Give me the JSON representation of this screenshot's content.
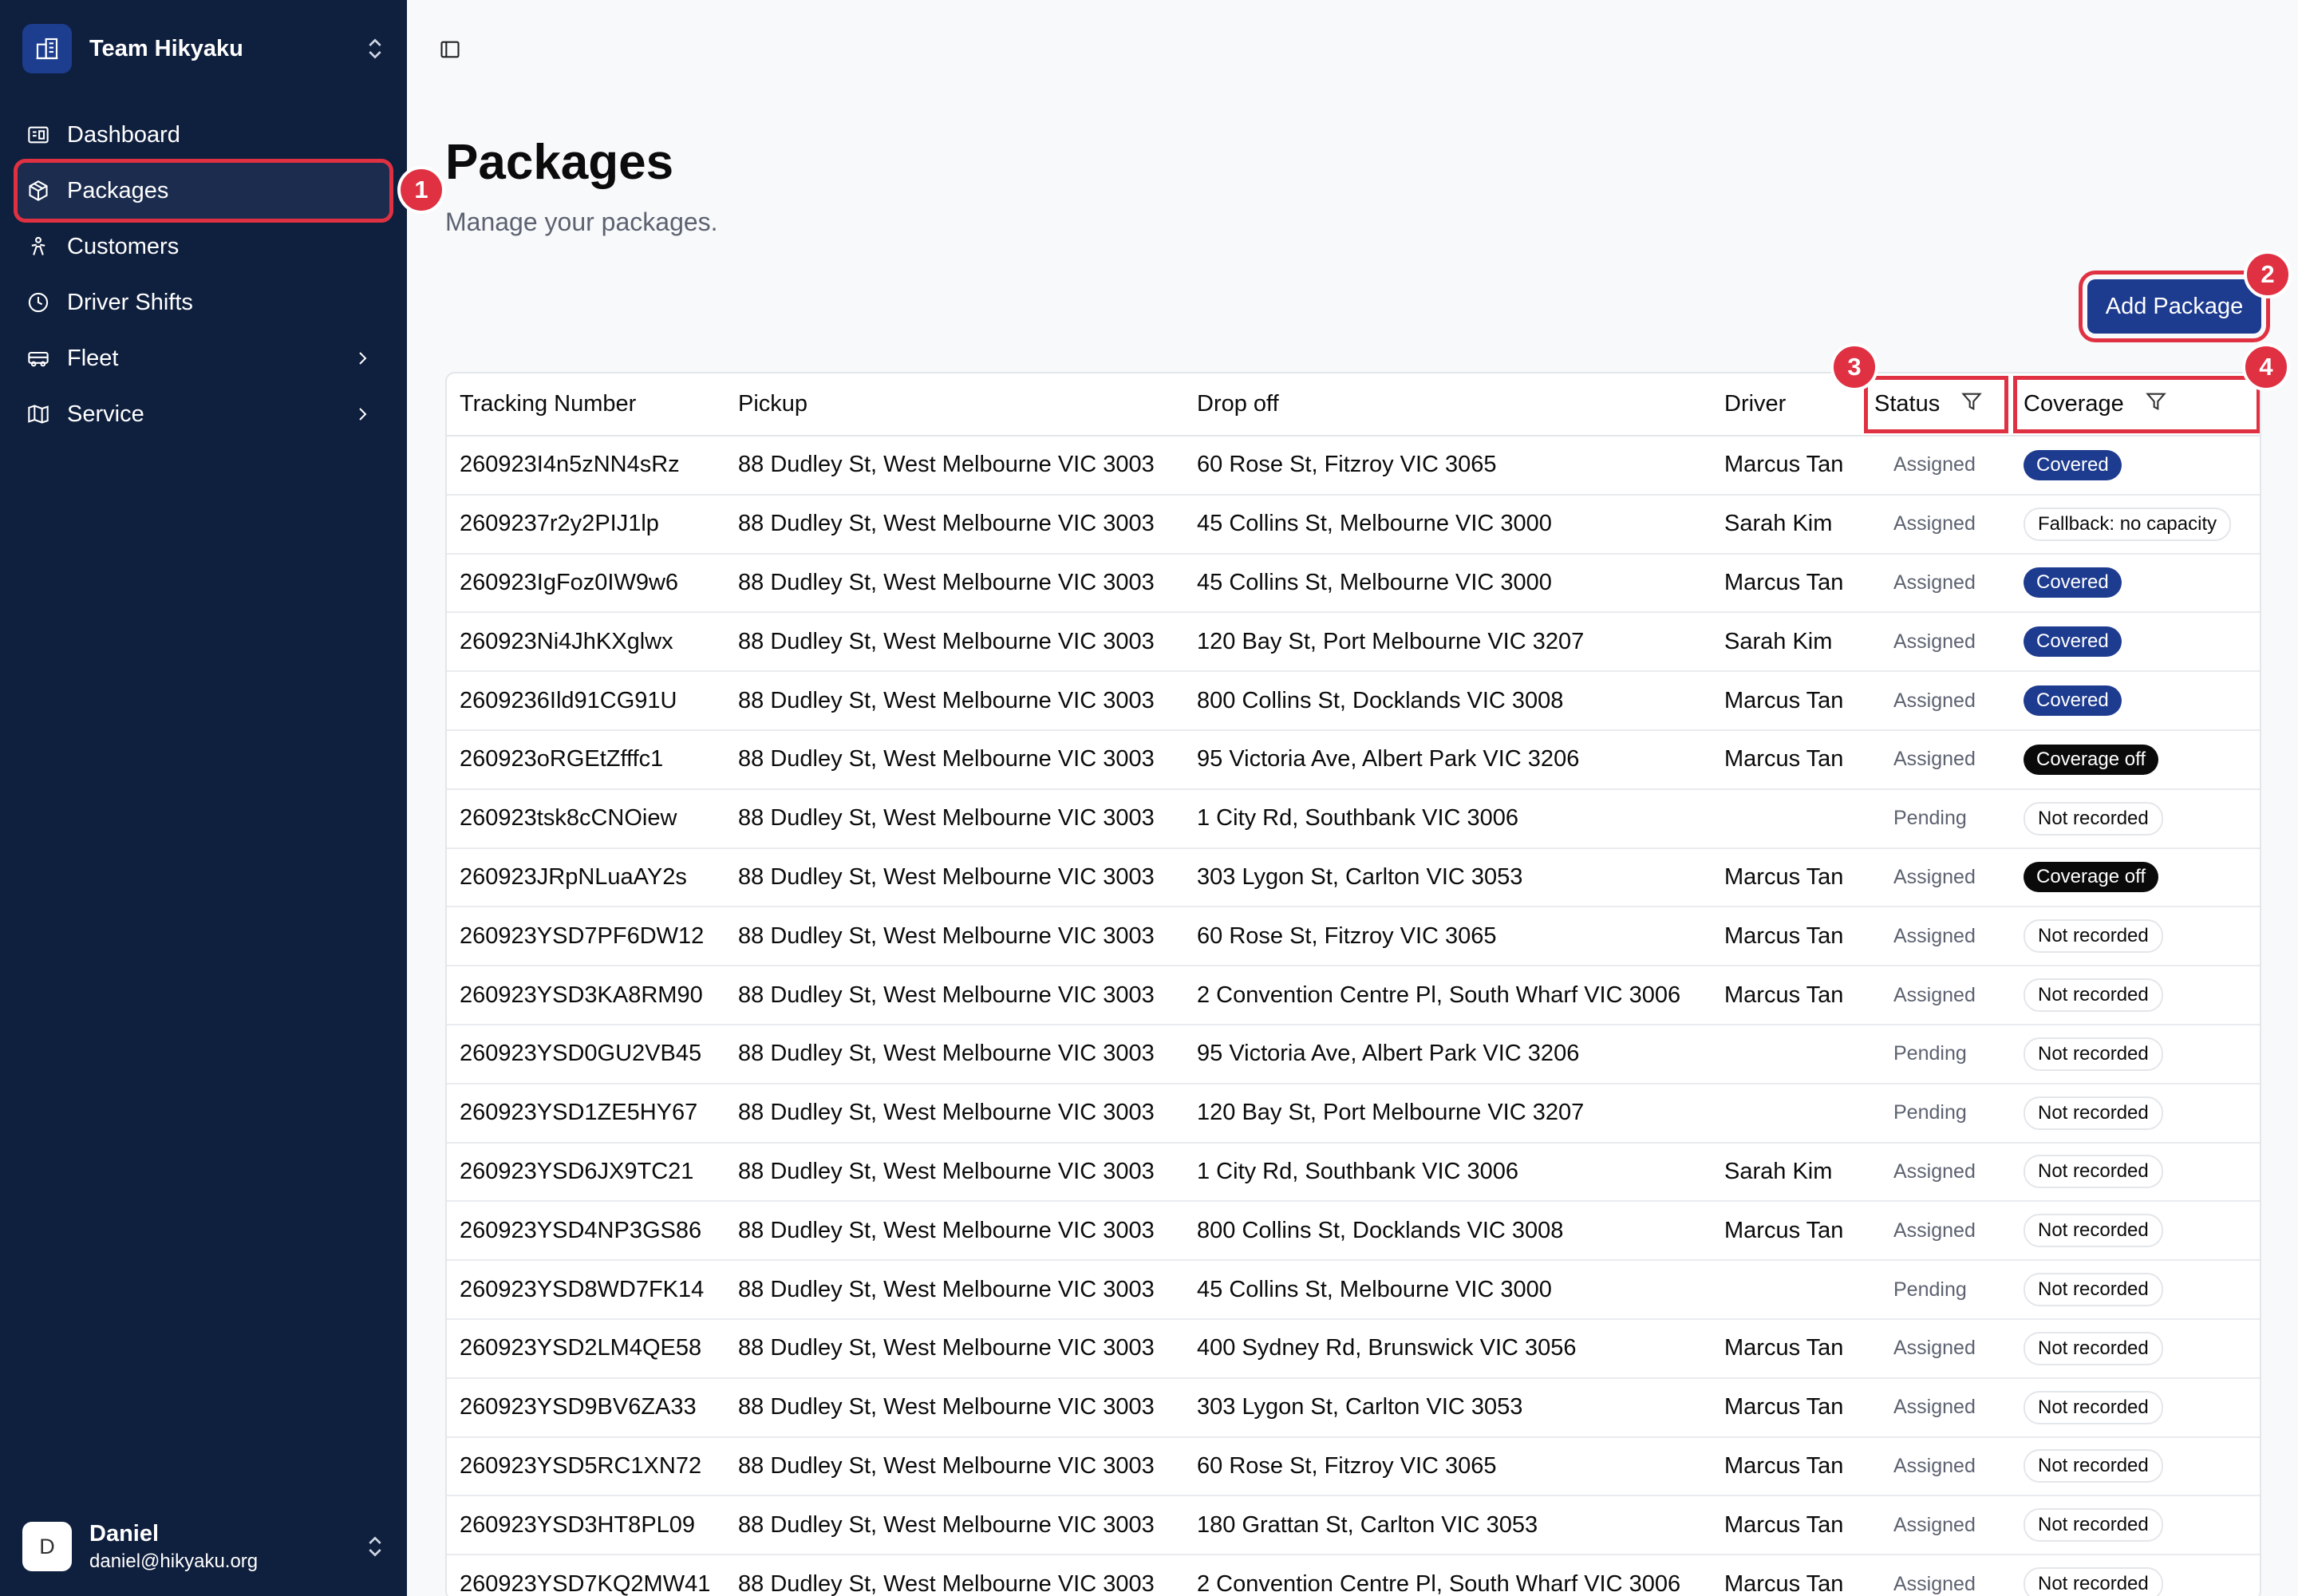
{
  "sidebar": {
    "team_name": "Team Hikyaku",
    "items": [
      {
        "label": "Dashboard",
        "icon": "dashboard-icon"
      },
      {
        "label": "Packages",
        "icon": "package-icon"
      },
      {
        "label": "Customers",
        "icon": "customers-icon"
      },
      {
        "label": "Driver Shifts",
        "icon": "clock-icon"
      },
      {
        "label": "Fleet",
        "icon": "truck-icon"
      },
      {
        "label": "Service",
        "icon": "map-icon"
      }
    ],
    "user": {
      "initial": "D",
      "name": "Daniel",
      "email": "daniel@hikyaku.org"
    }
  },
  "page": {
    "title": "Packages",
    "subtitle": "Manage your packages.",
    "add_button": "Add Package"
  },
  "table": {
    "headers": [
      "Tracking Number",
      "Pickup",
      "Drop off",
      "Driver",
      "Status",
      "Coverage"
    ],
    "rows": [
      [
        "260923I4n5zNN4sRz",
        "88 Dudley St, West Melbourne VIC 3003",
        "60 Rose St, Fitzroy VIC 3065",
        "Marcus Tan",
        "Assigned",
        "Covered"
      ],
      [
        "2609237r2y2PIJ1lp",
        "88 Dudley St, West Melbourne VIC 3003",
        "45 Collins St, Melbourne VIC 3000",
        "Sarah Kim",
        "Assigned",
        "Fallback: no capacity"
      ],
      [
        "260923IgFoz0IW9w6",
        "88 Dudley St, West Melbourne VIC 3003",
        "45 Collins St, Melbourne VIC 3000",
        "Marcus Tan",
        "Assigned",
        "Covered"
      ],
      [
        "260923Ni4JhKXglwx",
        "88 Dudley St, West Melbourne VIC 3003",
        "120 Bay St, Port Melbourne VIC 3207",
        "Sarah Kim",
        "Assigned",
        "Covered"
      ],
      [
        "2609236Ild91CG91U",
        "88 Dudley St, West Melbourne VIC 3003",
        "800 Collins St, Docklands VIC 3008",
        "Marcus Tan",
        "Assigned",
        "Covered"
      ],
      [
        "260923oRGEtZfffc1",
        "88 Dudley St, West Melbourne VIC 3003",
        "95 Victoria Ave, Albert Park VIC 3206",
        "Marcus Tan",
        "Assigned",
        "Coverage off"
      ],
      [
        "260923tsk8cCNOiew",
        "88 Dudley St, West Melbourne VIC 3003",
        "1 City Rd, Southbank VIC 3006",
        "",
        "Pending",
        "Not recorded"
      ],
      [
        "260923JRpNLuaAY2s",
        "88 Dudley St, West Melbourne VIC 3003",
        "303 Lygon St, Carlton VIC 3053",
        "Marcus Tan",
        "Assigned",
        "Coverage off"
      ],
      [
        "260923YSD7PF6DW12",
        "88 Dudley St, West Melbourne VIC 3003",
        "60 Rose St, Fitzroy VIC 3065",
        "Marcus Tan",
        "Assigned",
        "Not recorded"
      ],
      [
        "260923YSD3KA8RM90",
        "88 Dudley St, West Melbourne VIC 3003",
        "2 Convention Centre Pl, South Wharf VIC 3006",
        "Marcus Tan",
        "Assigned",
        "Not recorded"
      ],
      [
        "260923YSD0GU2VB45",
        "88 Dudley St, West Melbourne VIC 3003",
        "95 Victoria Ave, Albert Park VIC 3206",
        "",
        "Pending",
        "Not recorded"
      ],
      [
        "260923YSD1ZE5HY67",
        "88 Dudley St, West Melbourne VIC 3003",
        "120 Bay St, Port Melbourne VIC 3207",
        "",
        "Pending",
        "Not recorded"
      ],
      [
        "260923YSD6JX9TC21",
        "88 Dudley St, West Melbourne VIC 3003",
        "1 City Rd, Southbank VIC 3006",
        "Sarah Kim",
        "Assigned",
        "Not recorded"
      ],
      [
        "260923YSD4NP3GS86",
        "88 Dudley St, West Melbourne VIC 3003",
        "800 Collins St, Docklands VIC 3008",
        "Marcus Tan",
        "Assigned",
        "Not recorded"
      ],
      [
        "260923YSD8WD7FK14",
        "88 Dudley St, West Melbourne VIC 3003",
        "45 Collins St, Melbourne VIC 3000",
        "",
        "Pending",
        "Not recorded"
      ],
      [
        "260923YSD2LM4QE58",
        "88 Dudley St, West Melbourne VIC 3003",
        "400 Sydney Rd, Brunswick VIC 3056",
        "Marcus Tan",
        "Assigned",
        "Not recorded"
      ],
      [
        "260923YSD9BV6ZA33",
        "88 Dudley St, West Melbourne VIC 3003",
        "303 Lygon St, Carlton VIC 3053",
        "Marcus Tan",
        "Assigned",
        "Not recorded"
      ],
      [
        "260923YSD5RC1XN72",
        "88 Dudley St, West Melbourne VIC 3003",
        "60 Rose St, Fitzroy VIC 3065",
        "Marcus Tan",
        "Assigned",
        "Not recorded"
      ],
      [
        "260923YSD3HT8PL09",
        "88 Dudley St, West Melbourne VIC 3003",
        "180 Grattan St, Carlton VIC 3053",
        "Marcus Tan",
        "Assigned",
        "Not recorded"
      ],
      [
        "260923YSD7KQ2MW41",
        "88 Dudley St, West Melbourne VIC 3003",
        "2 Convention Centre Pl, South Wharf VIC 3006",
        "Marcus Tan",
        "Assigned",
        "Not recorded"
      ]
    ]
  },
  "markers": [
    "1",
    "2",
    "3",
    "4"
  ],
  "colors": {
    "sidebar": "#0f1f3e",
    "accent": "#1d3b8f",
    "highlight": "#e03142"
  }
}
